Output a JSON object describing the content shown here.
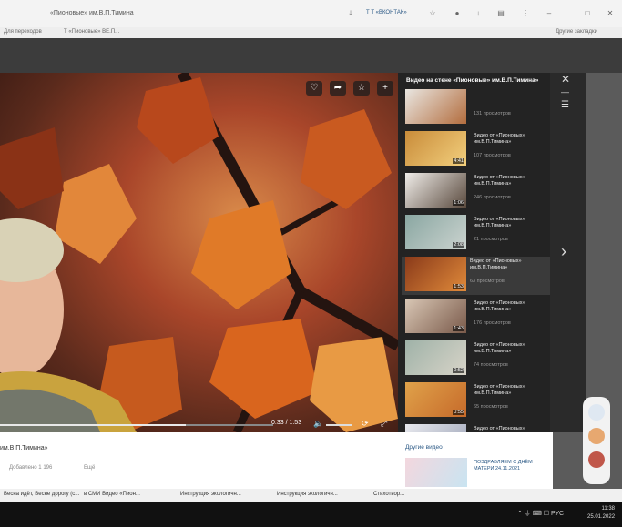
{
  "browser": {
    "tab_title": "«Пионовые» им.В.П.Тимина",
    "url_hint": "Т Т «ВКОНТАК»",
    "bookmarks": [
      "Для переходов",
      "Т «Пионовые» ВЕ.П..."
    ],
    "bookmark_right": "Другие закладки"
  },
  "player": {
    "time": "0:33 / 1:53",
    "progress": 0.68
  },
  "sidebar": {
    "title": "Видео на стене «Пионовые» им.В.П.Тимина»",
    "items": [
      {
        "title": "",
        "views": "131 просмотров",
        "duration": "",
        "colors": [
          "#e9e6e1",
          "#b36d3e"
        ]
      },
      {
        "title": "Видео от «Пионовых» им.В.П.Тимина»",
        "views": "107 просмотров",
        "duration": "4:41",
        "colors": [
          "#c98c3a",
          "#f2cf7d"
        ]
      },
      {
        "title": "Видео от «Пионовых» им.В.П.Тимина»",
        "views": "246 просмотров",
        "duration": "1:06",
        "colors": [
          "#f0ede9",
          "#5a4a3e"
        ]
      },
      {
        "title": "Видео от «Пионовых» им.В.П.Тимина»",
        "views": "21 просмотров",
        "duration": "2:08",
        "colors": [
          "#8aa7a2",
          "#cbd3cf"
        ]
      },
      {
        "title": "Видео от «Пионовых» им.В.П.Тимина»",
        "views": "63 просмотров",
        "duration": "1:53",
        "colors": [
          "#8a3a1a",
          "#e08a3a"
        ]
      },
      {
        "title": "Видео от «Пионовых» им.В.П.Тимина»",
        "views": "176 просмотров",
        "duration": "1:43",
        "colors": [
          "#d9c7b5",
          "#7a5a4a"
        ]
      },
      {
        "title": "Видео от «Пионовых» им.В.П.Тимина»",
        "views": "74 просмотров",
        "duration": "0:52",
        "colors": [
          "#9fb2a8",
          "#d8d4c8"
        ]
      },
      {
        "title": "Видео от «Пионовых» им.В.П.Тимина»",
        "views": "65 просмотров",
        "duration": "0:55",
        "colors": [
          "#e0a24a",
          "#c66a2a"
        ]
      },
      {
        "title": "Видео от «Пионовых» им.В.П.Тимина»",
        "views": "",
        "duration": "",
        "colors": [
          "#e8e9ee",
          "#9aa1b5"
        ]
      }
    ]
  },
  "below": {
    "title": "им.В.П.Тимина»",
    "meta": "Добавлено 1 196",
    "meta2": "Ещё",
    "more_title": "Другие видео",
    "more_text": "ПОЗДРАВЛЯЕМ С ДНЁМ МАТЕРИ 24.11.2021"
  },
  "bottom_strip": [
    "Весна идёт, Весне дорогу (с...",
    "в СМИ Видео «Пион...",
    "Инструкция экологичн...",
    "Инструкция экологичн...",
    "Стихотвор..."
  ],
  "taskbar": {
    "tray": "⌃ ⏚ ⌨ ☐ РУС",
    "clock_time": "11:38",
    "clock_date": "25.01.2022"
  }
}
